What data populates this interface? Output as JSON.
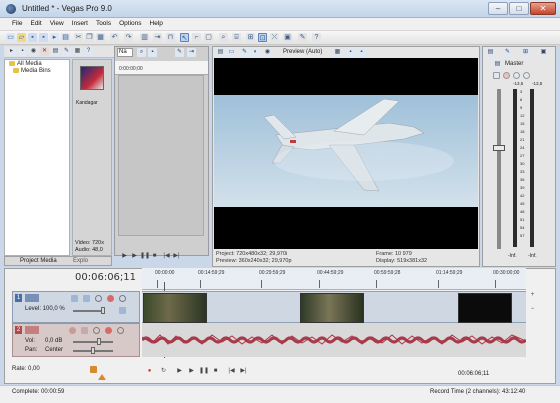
{
  "window": {
    "title": "Untitled * - Vegas Pro 9.0",
    "minimize": "–",
    "maximize": "□",
    "close": "✕"
  },
  "menu": [
    "File",
    "Edit",
    "View",
    "Insert",
    "Tools",
    "Options",
    "Help"
  ],
  "project_media": {
    "tree": [
      "All Media",
      "Media Bins"
    ],
    "thumbnail_label": "Kandagar",
    "info_lines": [
      "Video: 720x",
      "Audio: 48,0"
    ],
    "tabs": [
      "Project Media",
      "Explo"
    ]
  },
  "trimmer": {
    "dropdown_value": "Na",
    "timecode": "0:00:00;00"
  },
  "preview": {
    "mode_label": "Preview (Auto)",
    "project": "Project:  720x480x32; 29,970i",
    "preview_res": "Preview:  360x240x32; 29,970p",
    "frame": "Frame:     10 979",
    "display": "Display:    519x381x32"
  },
  "master": {
    "label": "Master",
    "scale": [
      "-13,5",
      "-13,5",
      "3",
      "6",
      "9",
      "12",
      "15",
      "18",
      "21",
      "24",
      "27",
      "30",
      "33",
      "36",
      "39",
      "42",
      "45",
      "48",
      "51",
      "54",
      "57"
    ],
    "bottom_values": [
      "-Inf.",
      "-Inf."
    ]
  },
  "timeline": {
    "current_time": "00:06:06;11",
    "ruler_ticks": [
      "00:00:00",
      "00:14:59;29",
      "00:29:59;29",
      "00:44:59;29",
      "00:59:59;28",
      "01:14:59;29",
      "00:30:00;00"
    ],
    "ruler_positions": [
      0.04,
      0.15,
      0.31,
      0.46,
      0.61,
      0.77,
      0.92
    ],
    "track1": {
      "number": "1",
      "level_label": "Level: 100,0 %"
    },
    "track2": {
      "number": "2",
      "vol_label": "Vol:",
      "vol_value": "0,0 dB",
      "pan_label": "Pan:",
      "pan_value": "Center"
    },
    "rate": "Rate: 0,00",
    "end_time": "00:06:06;11"
  },
  "status": {
    "left": "Complete: 00:00:59",
    "right": "Record Time (2 channels): 43:12:40"
  },
  "colors": {
    "track_video": "#cfd7e3",
    "audio_wave": "#9e2a3c",
    "sky": "#b6cfe1"
  }
}
